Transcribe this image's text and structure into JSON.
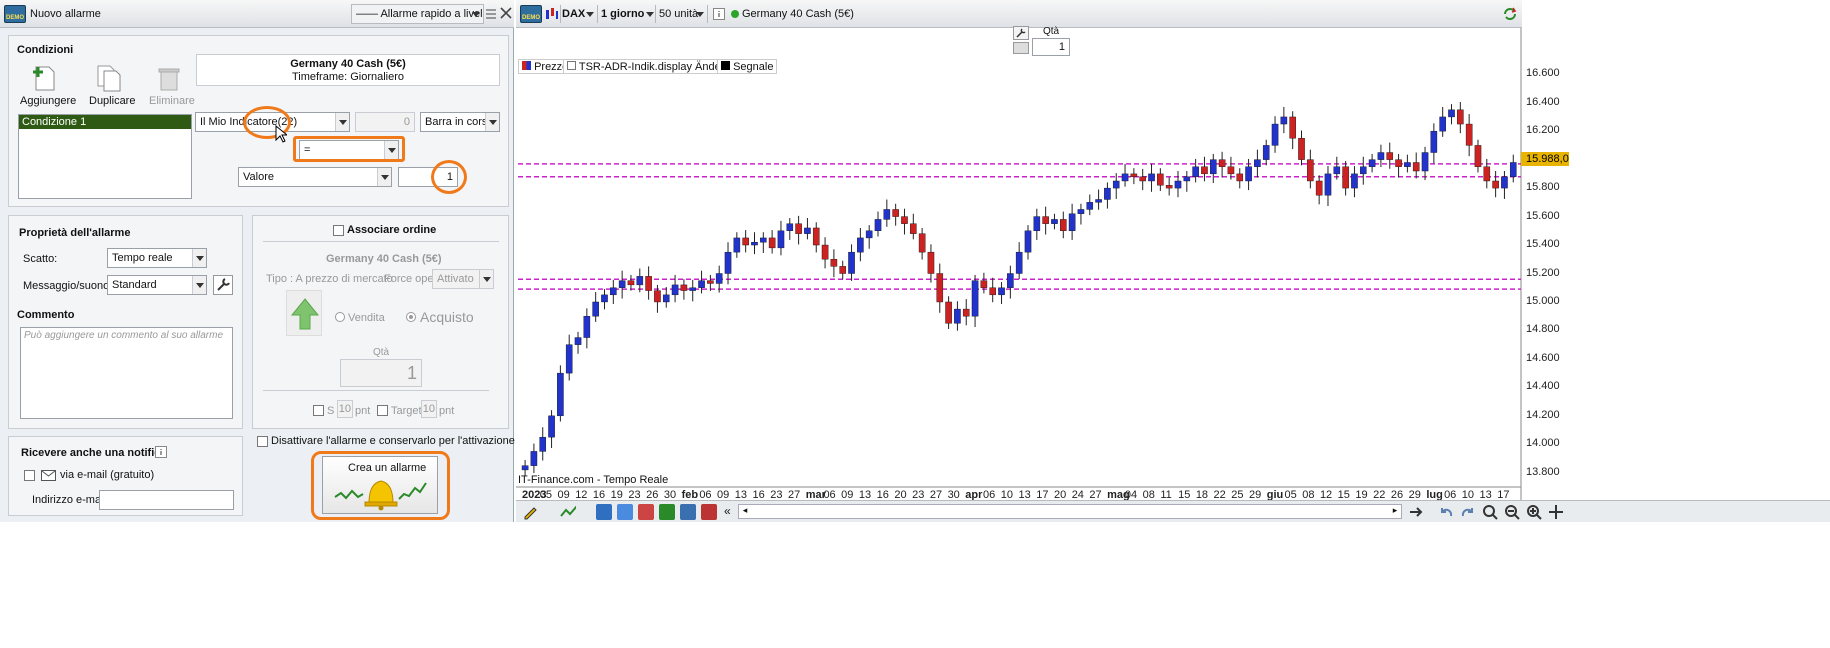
{
  "left_window": {
    "title": "Nuovo allarme",
    "mode_select": "—— Allarme rapido a livello",
    "conditions": {
      "header": "Condizioni",
      "add_label": "Aggiungere",
      "duplicate_label": "Duplicare",
      "delete_label": "Eliminare",
      "instrument_title": "Germany 40 Cash (5€)",
      "instrument_timeframe": "Timeframe: Giornaliero",
      "list_items": [
        "Condizione 1"
      ],
      "indicator_select": "Il Mio Indicatore(22)",
      "indicator_param": "0",
      "bar_select": "Barra in corso",
      "operator_select": "=",
      "value_select": "Valore",
      "value_input": "1"
    },
    "properties": {
      "header": "Proprietà dell'allarme",
      "trigger_label": "Scatto:",
      "trigger_value": "Tempo reale",
      "message_label": "Messaggio/suono:",
      "message_value": "Standard",
      "comment_header": "Commento",
      "comment_placeholder": "Può aggiungere un commento al suo allarme"
    },
    "order": {
      "associate_label": "Associare ordine",
      "instrument": "Germany 40 Cash (5€)",
      "type_label": "Tipo : A prezzo di mercato",
      "force_label": "Force open",
      "force_value": "Attivato",
      "sell_label": "Vendita",
      "buy_label": "Acquisto",
      "qty_label": "Qtà",
      "qty_value": "1",
      "stop_label": "S",
      "stop_value": "10",
      "stop_unit": "pnt",
      "target_label": "Target",
      "target_value": "10",
      "target_unit": "pnt"
    },
    "notify": {
      "header": "Ricevere anche una notifica",
      "email_label": "via e-mail (gratuito)",
      "address_label": "Indirizzo e-mail",
      "address_value": ""
    },
    "disable_label": "Disattivare l'allarme e conservarlo per l'attivazione futura",
    "create_button": "Crea un allarme"
  },
  "chart_window": {
    "symbol": "DAX",
    "timeframe": "1 giorno",
    "units": "50 unità",
    "instrument": "Germany 40 Cash (5€)",
    "qty_label": "Qtà",
    "qty_value": "1",
    "legend": [
      "Prezzo",
      "TSR-ADR-Indik.display Änderung",
      "Segnale"
    ],
    "watermark": "IT-Finance.com - Tempo Reale",
    "price_tag": "15.988,0",
    "colors": {
      "up": "#2233cc",
      "down": "#cc2222",
      "level_line": "#cc22cc",
      "price_tag": "#e8b400",
      "highlight": "#f07a1a"
    }
  },
  "chart_data": {
    "type": "candlestick",
    "title": "",
    "ylim": [
      13.7,
      16.7
    ],
    "yticks": [
      "16.600",
      "16.400",
      "16.200",
      "16.000",
      "15.800",
      "15.600",
      "15.400",
      "15.200",
      "15.000",
      "14.800",
      "14.600",
      "14.400",
      "14.200",
      "14.000",
      "13.800"
    ],
    "xticks": [
      "2023",
      "05",
      "09",
      "12",
      "16",
      "19",
      "23",
      "26",
      "30",
      "feb",
      "06",
      "09",
      "13",
      "16",
      "23",
      "27",
      "mar",
      "06",
      "09",
      "13",
      "16",
      "20",
      "23",
      "27",
      "30",
      "apr",
      "06",
      "10",
      "13",
      "17",
      "20",
      "24",
      "27",
      "mag",
      "04",
      "08",
      "11",
      "15",
      "18",
      "22",
      "25",
      "29",
      "giu",
      "05",
      "08",
      "12",
      "15",
      "19",
      "22",
      "26",
      "29",
      "lug",
      "06",
      "10",
      "13",
      "17"
    ],
    "level_lines": [
      15.97,
      15.88,
      15.16,
      15.09
    ],
    "closes": [
      13.85,
      13.95,
      14.05,
      14.2,
      14.5,
      14.7,
      14.75,
      14.9,
      15.0,
      15.05,
      15.1,
      15.15,
      15.12,
      15.18,
      15.08,
      15.0,
      15.05,
      15.12,
      15.08,
      15.1,
      15.15,
      15.13,
      15.2,
      15.35,
      15.45,
      15.4,
      15.42,
      15.45,
      15.38,
      15.5,
      15.55,
      15.48,
      15.52,
      15.4,
      15.3,
      15.25,
      15.2,
      15.35,
      15.45,
      15.5,
      15.58,
      15.65,
      15.6,
      15.55,
      15.48,
      15.35,
      15.2,
      15.0,
      14.85,
      14.95,
      14.9,
      15.15,
      15.1,
      15.05,
      15.1,
      15.2,
      15.35,
      15.5,
      15.6,
      15.55,
      15.58,
      15.5,
      15.62,
      15.65,
      15.7,
      15.72,
      15.8,
      15.85,
      15.9,
      15.88,
      15.85,
      15.9,
      15.82,
      15.8,
      15.85,
      15.88,
      15.95,
      15.9,
      16.0,
      15.95,
      15.9,
      15.85,
      15.95,
      16.0,
      16.1,
      16.25,
      16.3,
      16.15,
      16.0,
      15.85,
      15.75,
      15.9,
      15.95,
      15.8,
      15.9,
      15.95,
      16.0,
      16.05,
      16.0,
      15.95,
      15.98,
      15.92,
      16.05,
      16.2,
      16.3,
      16.35,
      16.25,
      16.1,
      15.95,
      15.85,
      15.8,
      15.88,
      15.98
    ]
  }
}
